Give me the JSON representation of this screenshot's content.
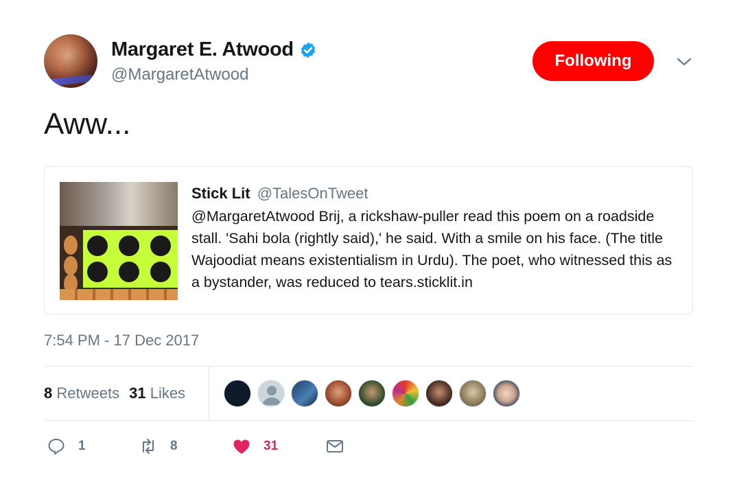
{
  "author": {
    "name": "Margaret E. Atwood",
    "handle": "@MargaretAtwood",
    "avatar_icon": "profile-photo-icon",
    "verified_icon": "verified-badge-icon"
  },
  "follow_button": {
    "label": "Following",
    "color": "#ff0000"
  },
  "menu_icon": "chevron-down-icon",
  "tweet": {
    "text": "Aww..."
  },
  "quoted_tweet": {
    "name": "Stick Lit",
    "handle": "@TalesOnTweet",
    "text": "@MargaretAtwood Brij, a rickshaw-puller read this poem on a roadside stall. 'Sahi bola (rightly said),' he said. With a smile on his face. (The title Wajoodiat means existentialism in Urdu). The poet, who witnessed this as a bystander, was reduced to tears.sticklit.in",
    "image_icon": "quoted-photo-icon"
  },
  "timestamp": "7:54 PM - 17 Dec 2017",
  "stats": {
    "retweets_count": "8",
    "retweets_label": "Retweets",
    "likes_count": "31",
    "likes_label": "Likes"
  },
  "likers_avatar_count": 9,
  "actions": {
    "reply": {
      "icon": "reply-icon",
      "count": "1"
    },
    "retweet": {
      "icon": "retweet-icon",
      "count": "8"
    },
    "like": {
      "icon": "heart-icon",
      "count": "31",
      "color": "#e0245e"
    },
    "message": {
      "icon": "envelope-icon"
    }
  },
  "colors": {
    "text": "#14171a",
    "secondary": "#657786",
    "border": "#e1e8ed",
    "verified": "#1da1f2"
  }
}
